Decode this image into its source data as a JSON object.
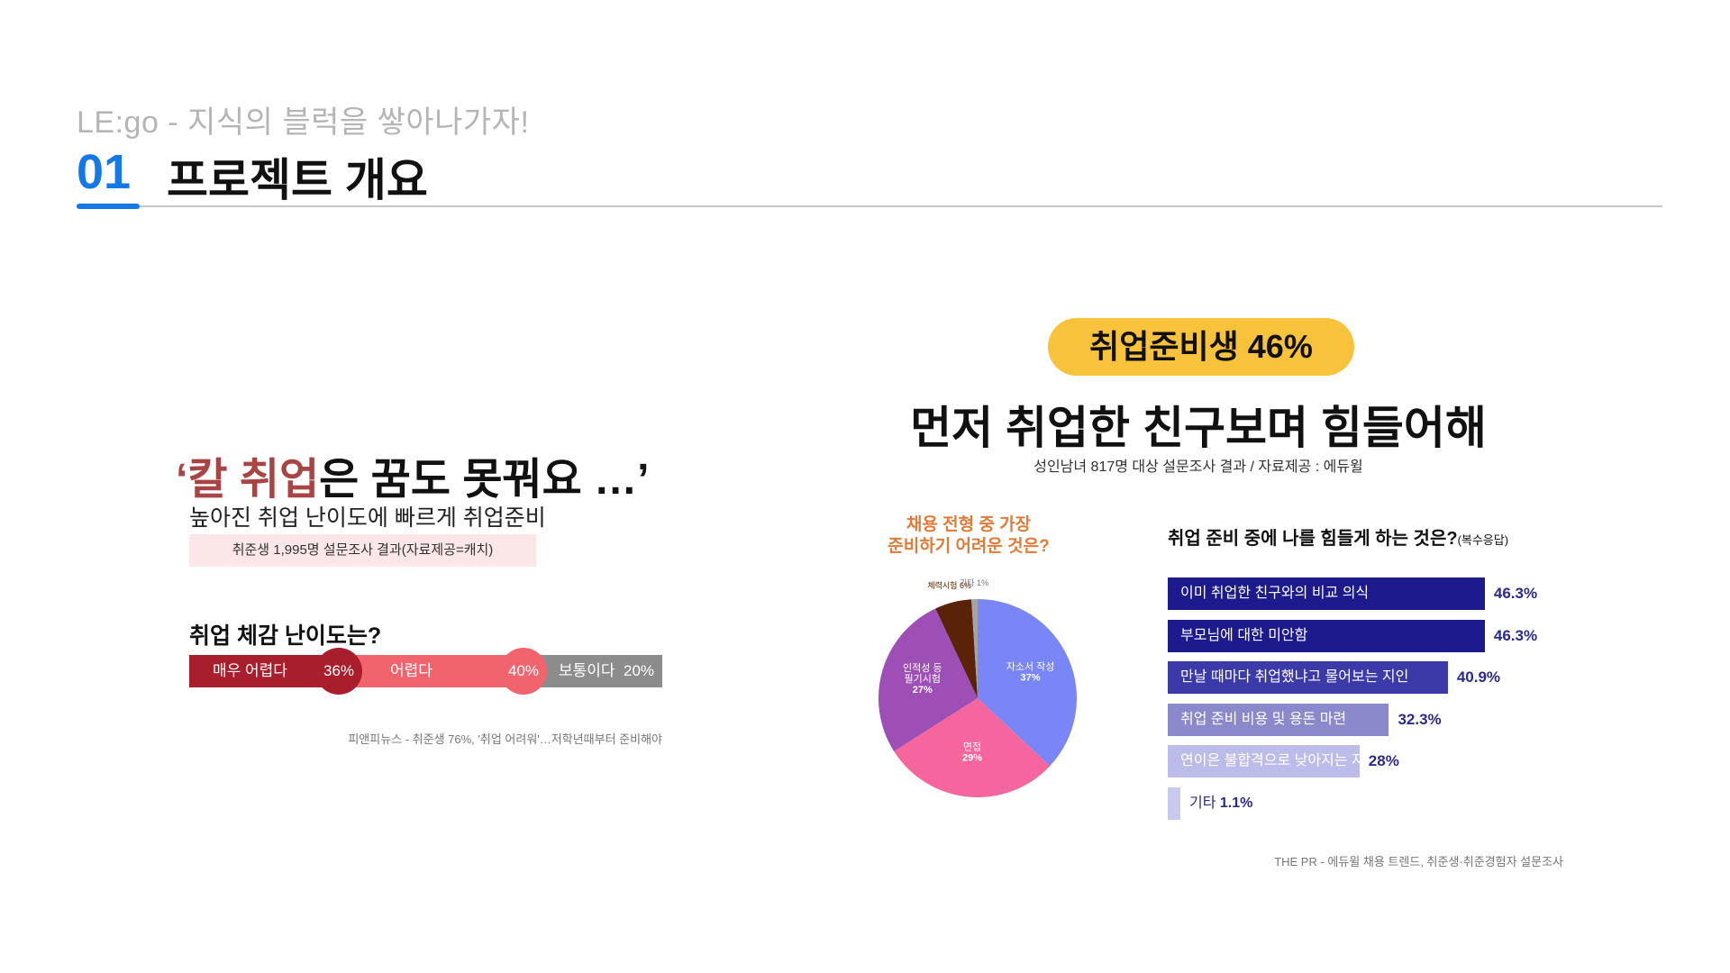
{
  "header": {
    "subtitle": "LE:go - 지식의 블럭을 쌓아나가자!",
    "section_number": "01",
    "section_title": "프로젝트 개요",
    "accent_color": "#1479e6"
  },
  "left": {
    "quote_open": "‘",
    "quote_highlight": "칼 취업",
    "quote_rest": "은 꿈도 못꿔요 …’",
    "subtitle": "높아진 취업 난이도에 빠르게 취업준비",
    "source_box": "취준생 1,995명 설문조사 결과(자료제공=캐치)",
    "difficulty_title": "취업 체감 난이도는?",
    "difficulty": [
      {
        "label": "매우 어렵다",
        "value": "36%",
        "color": "#a91e2c"
      },
      {
        "label": "어렵다",
        "value": "40%",
        "color": "#f1636d"
      },
      {
        "label": "보통이다",
        "value": "20%",
        "color": "#8c8c8c"
      }
    ],
    "source": "피앤피뉴스 - 취준생 76%, '취업 어려워'…저학년때부터 준비해야"
  },
  "right": {
    "badge": "취업준비생 46%",
    "title": "먼저 취업한 친구보며 힘들어해",
    "source_line": "성인남녀 817명 대상 설문조사 결과 / 자료제공 : 에듀윌",
    "pie_title_1": "채용 전형 중 가장",
    "pie_title_2": "준비하기 어려운 것은?",
    "bar_title": "취업 준비 중에 나를 힘들게 하는 것은?",
    "bar_title_note": "(복수응답)",
    "source": "THE PR - 에듀윌 채용 트렌드, 취준생·취준경험자 설문조사"
  },
  "chart_data": [
    {
      "type": "pie",
      "title": "채용 전형 중 가장 준비하기 어려운 것은?",
      "slices": [
        {
          "label": "자소서 작성",
          "value": 37,
          "display": "37%",
          "color": "#7a86f7"
        },
        {
          "label": "면접",
          "value": 29,
          "display": "29%",
          "color": "#f4669d"
        },
        {
          "label": "인적성 등 필기시험",
          "value": 27,
          "display": "27%",
          "color": "#9d4fb6"
        },
        {
          "label": "체력시험",
          "value": 6,
          "display": "6%",
          "color": "#5a2207"
        },
        {
          "label": "기타",
          "value": 1,
          "display": "1%",
          "color": "#a3a3a3"
        }
      ]
    },
    {
      "type": "bar",
      "title": "취업 준비 중에 나를 힘들게 하는 것은?(복수응답)",
      "orientation": "horizontal",
      "categories": [
        "이미 취업한 친구와의 비교 의식",
        "부모님에 대한 미안함",
        "만날 때마다 취업했냐고 물어보는 지인",
        "취업 준비 비용 및 용돈 마련",
        "연이은 불합격으로 낮아지는 자신감",
        "기타"
      ],
      "values": [
        46.3,
        46.3,
        40.9,
        32.3,
        28,
        1.1
      ],
      "value_labels": [
        "46.3%",
        "46.3%",
        "40.9%",
        "32.3%",
        "28%",
        "1.1%"
      ],
      "colors": [
        "#1c1a8c",
        "#1c1a8c",
        "#3b3aa8",
        "#8a89cc",
        "#bcbcea",
        "#c9c9ef"
      ],
      "label_colors": [
        "#ffffff",
        "#ffffff",
        "#ffffff",
        "#ffffff",
        "#ffffff",
        "#2a2a8c"
      ],
      "value_color": "#2a2a8c",
      "xlim": [
        0,
        50
      ]
    }
  ]
}
